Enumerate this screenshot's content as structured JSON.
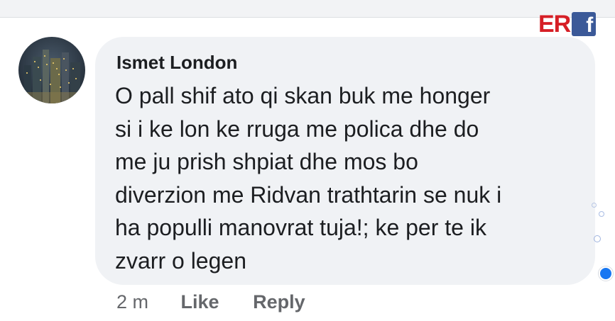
{
  "logo": {
    "text": "ER",
    "fb_letter": "f",
    "brand_red": "#d61f26",
    "brand_blue": "#3b5998"
  },
  "comment": {
    "author": "Ismet London",
    "lines": [
      "O pall shif ato qi skan buk me honger",
      "si i ke lon ke rruga me polica dhe do",
      "me ju prish shpiat dhe mos bo",
      "diverzion me Ridvan trathtarin se nuk i",
      "ha populli manovrat tuja!; ke per te ik",
      "zvarr o legen"
    ],
    "time": "2 m",
    "like_label": "Like",
    "reply_label": "Reply"
  },
  "colors": {
    "bubble": "#f0f2f5",
    "text": "#1c1e21",
    "meta": "#65676b",
    "reaction": "#1877f2"
  }
}
